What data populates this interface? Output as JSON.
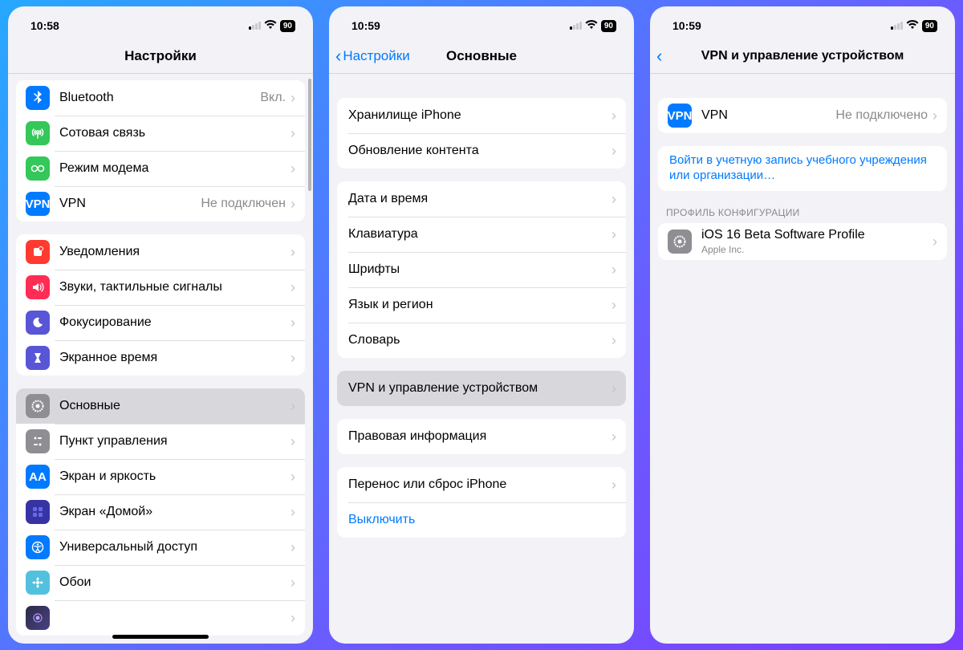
{
  "screens": [
    {
      "time": "10:58",
      "battery": "90",
      "nav": {
        "title": "Настройки",
        "back": null
      },
      "groups": [
        {
          "cells": [
            {
              "key": "bluetooth",
              "icon": "ic-bluetooth",
              "glyph": "⌵",
              "label": "Bluetooth",
              "value": "Вкл."
            },
            {
              "key": "cellular",
              "icon": "ic-cell",
              "glyph": "((•))",
              "label": "Сотовая связь"
            },
            {
              "key": "hotspot",
              "icon": "ic-hotspot",
              "glyph": "☍",
              "label": "Режим модема"
            },
            {
              "key": "vpn",
              "icon": "ic-vpn",
              "glyph": "VPN",
              "label": "VPN",
              "value": "Не подключен"
            }
          ]
        },
        {
          "cells": [
            {
              "key": "notifications",
              "icon": "ic-notif",
              "glyph": "☐",
              "label": "Уведомления"
            },
            {
              "key": "sounds",
              "icon": "ic-sound",
              "glyph": "◀)",
              "label": "Звуки, тактильные сигналы"
            },
            {
              "key": "focus",
              "icon": "ic-focus",
              "glyph": "☾",
              "label": "Фокусирование"
            },
            {
              "key": "screentime",
              "icon": "ic-screen",
              "glyph": "⧗",
              "label": "Экранное время"
            }
          ]
        },
        {
          "cells": [
            {
              "key": "general",
              "icon": "ic-general",
              "glyph": "⚙",
              "label": "Основные",
              "highlight": true
            },
            {
              "key": "control",
              "icon": "ic-control",
              "glyph": "⋮⋮",
              "label": "Пункт управления"
            },
            {
              "key": "display",
              "icon": "ic-display",
              "glyph": "AA",
              "label": "Экран и яркость"
            },
            {
              "key": "home",
              "icon": "ic-home",
              "glyph": "▦",
              "label": "Экран «Домой»"
            },
            {
              "key": "access",
              "icon": "ic-access",
              "glyph": "⊕",
              "label": "Универсальный доступ"
            },
            {
              "key": "wallpaper",
              "icon": "ic-wall",
              "glyph": "❀",
              "label": "Обои"
            },
            {
              "key": "siri",
              "icon": "ic-siri",
              "glyph": "◉",
              "label": ""
            }
          ]
        }
      ]
    },
    {
      "time": "10:59",
      "battery": "90",
      "nav": {
        "title": "Основные",
        "back": "Настройки"
      },
      "groups": [
        {
          "cells": [
            {
              "key": "storage",
              "label": "Хранилище iPhone"
            },
            {
              "key": "refresh",
              "label": "Обновление контента"
            }
          ]
        },
        {
          "cells": [
            {
              "key": "datetime",
              "label": "Дата и время"
            },
            {
              "key": "keyboard",
              "label": "Клавиатура"
            },
            {
              "key": "fonts",
              "label": "Шрифты"
            },
            {
              "key": "lang",
              "label": "Язык и регион"
            },
            {
              "key": "dict",
              "label": "Словарь"
            }
          ]
        },
        {
          "cells": [
            {
              "key": "vpnmgmt",
              "label": "VPN и управление устройством",
              "highlight": true
            }
          ]
        },
        {
          "cells": [
            {
              "key": "legal",
              "label": "Правовая информация"
            }
          ]
        },
        {
          "cells": [
            {
              "key": "transfer",
              "label": "Перенос или сброс iPhone"
            },
            {
              "key": "shutdown",
              "label": "Выключить",
              "link": true,
              "noChevron": true
            }
          ]
        }
      ]
    },
    {
      "time": "10:59",
      "battery": "90",
      "nav": {
        "title": "VPN и управление устройством",
        "back": ""
      },
      "groups": [
        {
          "cells": [
            {
              "key": "vpn",
              "icon": "ic-vpn",
              "glyph": "VPN",
              "label": "VPN",
              "value": "Не подключено"
            }
          ]
        },
        {
          "cells": [
            {
              "key": "signin",
              "label": "Войти в учетную запись учебного учреждения или организации…",
              "link": true,
              "noChevron": true,
              "twoLine": true
            }
          ]
        }
      ],
      "section_header": "ПРОФИЛЬ КОНФИГУРАЦИИ",
      "profile_group": {
        "cells": [
          {
            "key": "profile",
            "icon": "ic-profile",
            "glyph": "⚙",
            "label": "iOS 16 Beta Software Profile",
            "sub": "Apple Inc."
          }
        ]
      }
    }
  ]
}
